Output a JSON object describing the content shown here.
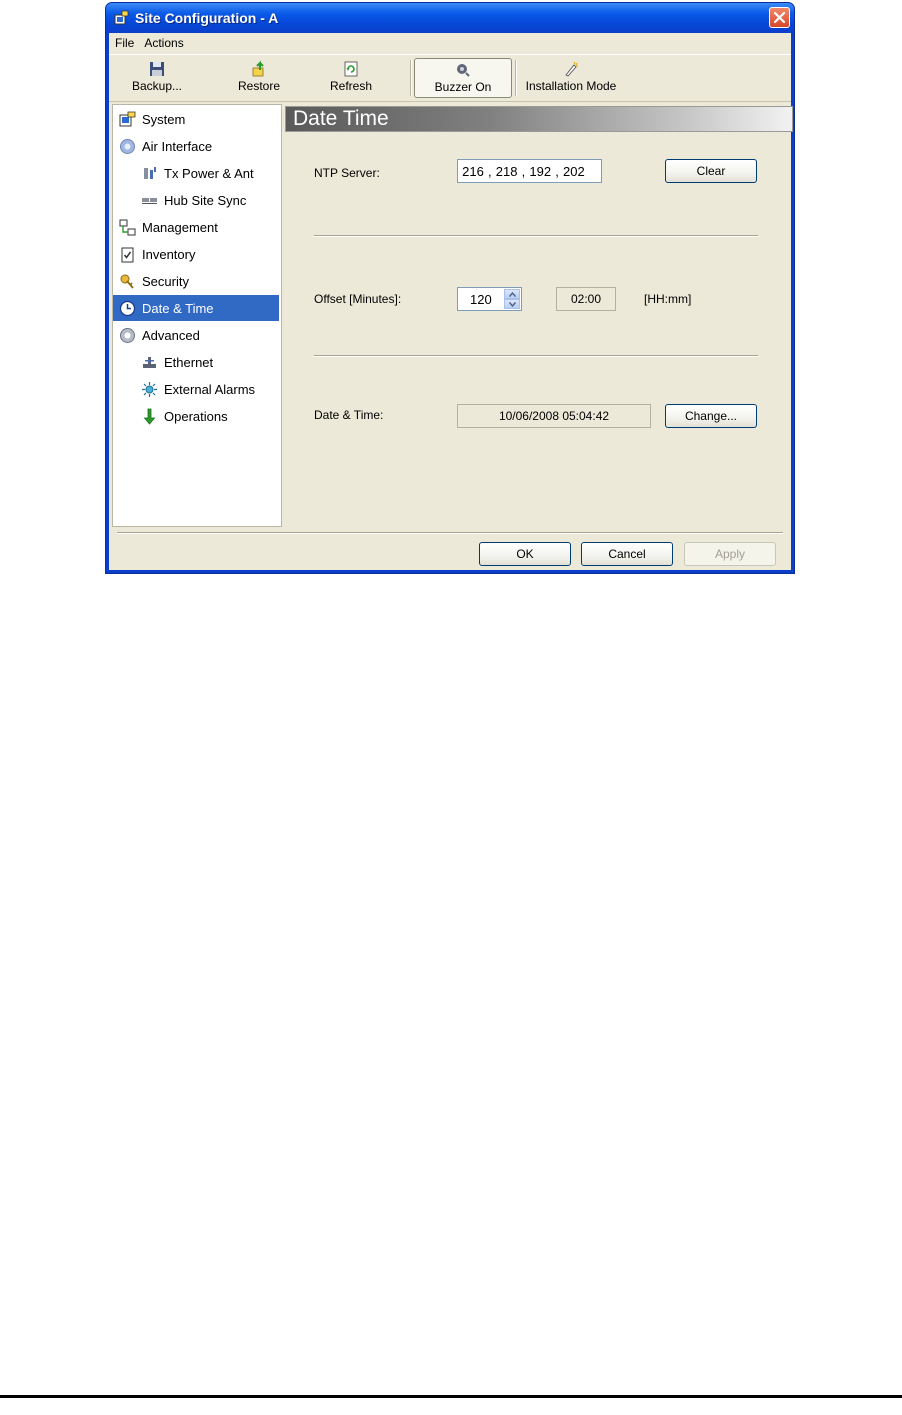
{
  "window": {
    "title": "Site Configuration - A"
  },
  "menu": [
    "File",
    "Actions"
  ],
  "toolbar": {
    "backup": "Backup...",
    "restore": "Restore",
    "refresh": "Refresh",
    "buzzer": "Buzzer On",
    "installation": "Installation Mode"
  },
  "nav": [
    {
      "label": "System",
      "icon": "system-icon"
    },
    {
      "label": "Air Interface",
      "icon": "air-interface-icon"
    },
    {
      "label": "Tx Power & Ant",
      "icon": "tx-power-icon"
    },
    {
      "label": "Hub Site Sync",
      "icon": "hub-site-sync-icon"
    },
    {
      "label": "Management",
      "icon": "management-icon"
    },
    {
      "label": "Inventory",
      "icon": "inventory-icon"
    },
    {
      "label": "Security",
      "icon": "security-icon"
    },
    {
      "label": "Date & Time",
      "icon": "clock-icon",
      "selected": true
    },
    {
      "label": "Advanced",
      "icon": "advanced-icon"
    },
    {
      "label": "Ethernet",
      "icon": "ethernet-icon"
    },
    {
      "label": "External Alarms",
      "icon": "external-alarms-icon"
    },
    {
      "label": "Operations",
      "icon": "operations-icon"
    }
  ],
  "panel": {
    "header": "Date  Time",
    "ntp_label": "NTP Server:",
    "ntp_octets": [
      "216",
      "218",
      "192",
      "202"
    ],
    "clear_label": "Clear",
    "offset_label": "Offset [Minutes]:",
    "offset_value": "120",
    "offset_hhmm": "02:00",
    "offset_unit": "[HH:mm]",
    "datetime_label": "Date & Time:",
    "datetime_value": "10/06/2008 05:04:42",
    "change_label": "Change..."
  },
  "footer": {
    "ok": "OK",
    "cancel": "Cancel",
    "apply": "Apply"
  },
  "colors": {
    "title_bar": "#0a5ae8",
    "selection": "#316ac5",
    "window_bg": "#ece9d8"
  }
}
